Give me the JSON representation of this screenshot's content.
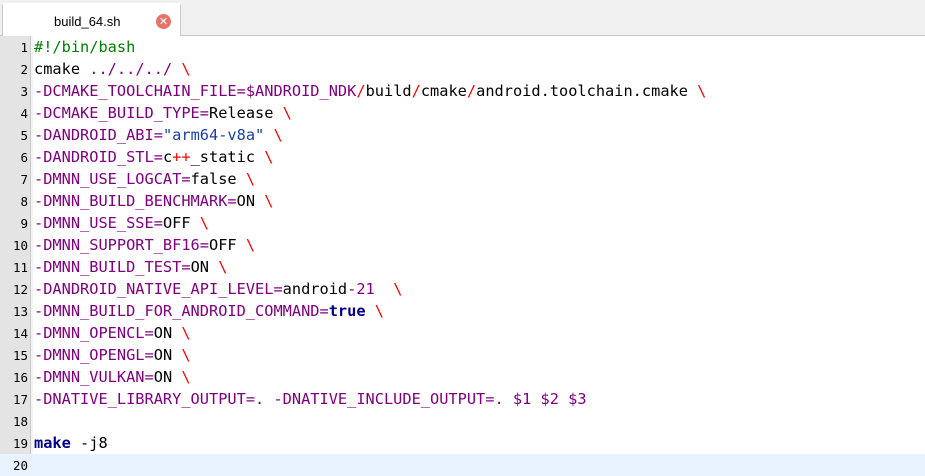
{
  "tab": {
    "label": "build_64.sh",
    "close_icon": "close-icon"
  },
  "colors": {
    "comment": "#008000",
    "option": "#800080",
    "escape": "#ff0000",
    "string": "#1c3ea8",
    "keyword": "#00008b",
    "current_line": "#e8f2fe"
  },
  "lines": [
    {
      "n": "1",
      "tokens": [
        {
          "t": "#!/bin/bash",
          "c": "comment"
        }
      ]
    },
    {
      "n": "2",
      "tokens": [
        {
          "t": "cmake ",
          "c": "plain"
        },
        {
          "t": "../../../",
          "c": "opt"
        },
        {
          "t": " ",
          "c": "plain"
        },
        {
          "t": "\\",
          "c": "esc"
        }
      ]
    },
    {
      "n": "3",
      "tokens": [
        {
          "t": "-DCMAKE_TOOLCHAIN_FILE=$ANDROID_NDK",
          "c": "opt"
        },
        {
          "t": "/",
          "c": "esc"
        },
        {
          "t": "build",
          "c": "plain"
        },
        {
          "t": "/",
          "c": "esc"
        },
        {
          "t": "cmake",
          "c": "plain"
        },
        {
          "t": "/",
          "c": "esc"
        },
        {
          "t": "android.toolchain.cmake ",
          "c": "plain"
        },
        {
          "t": "\\",
          "c": "esc"
        }
      ]
    },
    {
      "n": "4",
      "tokens": [
        {
          "t": "-DCMAKE_BUILD_TYPE=",
          "c": "opt"
        },
        {
          "t": "Release ",
          "c": "plain"
        },
        {
          "t": "\\",
          "c": "esc"
        }
      ]
    },
    {
      "n": "5",
      "tokens": [
        {
          "t": "-DANDROID_ABI=",
          "c": "opt"
        },
        {
          "t": "\"arm64-v8a\"",
          "c": "str"
        },
        {
          "t": " ",
          "c": "plain"
        },
        {
          "t": "\\",
          "c": "esc"
        }
      ]
    },
    {
      "n": "6",
      "tokens": [
        {
          "t": "-DANDROID_STL=",
          "c": "opt"
        },
        {
          "t": "c",
          "c": "plain"
        },
        {
          "t": "++",
          "c": "esc"
        },
        {
          "t": "_static ",
          "c": "plain"
        },
        {
          "t": "\\",
          "c": "esc"
        }
      ]
    },
    {
      "n": "7",
      "tokens": [
        {
          "t": "-DMNN_USE_LOGCAT=",
          "c": "opt"
        },
        {
          "t": "false ",
          "c": "plain"
        },
        {
          "t": "\\",
          "c": "esc"
        }
      ]
    },
    {
      "n": "8",
      "tokens": [
        {
          "t": "-DMNN_BUILD_BENCHMARK=",
          "c": "opt"
        },
        {
          "t": "ON ",
          "c": "plain"
        },
        {
          "t": "\\",
          "c": "esc"
        }
      ]
    },
    {
      "n": "9",
      "tokens": [
        {
          "t": "-DMNN_USE_SSE=",
          "c": "opt"
        },
        {
          "t": "OFF ",
          "c": "plain"
        },
        {
          "t": "\\",
          "c": "esc"
        }
      ]
    },
    {
      "n": "10",
      "tokens": [
        {
          "t": "-DMNN_SUPPORT_BF16=",
          "c": "opt"
        },
        {
          "t": "OFF ",
          "c": "plain"
        },
        {
          "t": "\\",
          "c": "esc"
        }
      ]
    },
    {
      "n": "11",
      "tokens": [
        {
          "t": "-DMNN_BUILD_TEST=",
          "c": "opt"
        },
        {
          "t": "ON ",
          "c": "plain"
        },
        {
          "t": "\\",
          "c": "esc"
        }
      ]
    },
    {
      "n": "12",
      "tokens": [
        {
          "t": "-DANDROID_NATIVE_API_LEVEL=",
          "c": "opt"
        },
        {
          "t": "android",
          "c": "plain"
        },
        {
          "t": "-21",
          "c": "opt"
        },
        {
          "t": "  ",
          "c": "plain"
        },
        {
          "t": "\\",
          "c": "esc"
        }
      ]
    },
    {
      "n": "13",
      "tokens": [
        {
          "t": "-DMNN_BUILD_FOR_ANDROID_COMMAND=",
          "c": "opt"
        },
        {
          "t": "true",
          "c": "kw"
        },
        {
          "t": " ",
          "c": "plain"
        },
        {
          "t": "\\",
          "c": "esc"
        }
      ]
    },
    {
      "n": "14",
      "tokens": [
        {
          "t": "-DMNN_OPENCL=",
          "c": "opt"
        },
        {
          "t": "ON ",
          "c": "plain"
        },
        {
          "t": "\\",
          "c": "esc"
        }
      ]
    },
    {
      "n": "15",
      "tokens": [
        {
          "t": "-DMNN_OPENGL=",
          "c": "opt"
        },
        {
          "t": "ON ",
          "c": "plain"
        },
        {
          "t": "\\",
          "c": "esc"
        }
      ]
    },
    {
      "n": "16",
      "tokens": [
        {
          "t": "-DMNN_VULKAN=",
          "c": "opt"
        },
        {
          "t": "ON ",
          "c": "plain"
        },
        {
          "t": "\\",
          "c": "esc"
        }
      ]
    },
    {
      "n": "17",
      "tokens": [
        {
          "t": "-DNATIVE_LIBRARY_OUTPUT=. -DNATIVE_INCLUDE_OUTPUT=. $1 $2 $3",
          "c": "opt"
        }
      ]
    },
    {
      "n": "18",
      "tokens": []
    },
    {
      "n": "19",
      "tokens": [
        {
          "t": "make",
          "c": "kw"
        },
        {
          "t": " -j8",
          "c": "plain"
        }
      ]
    },
    {
      "n": "20",
      "tokens": [],
      "current": true
    }
  ]
}
